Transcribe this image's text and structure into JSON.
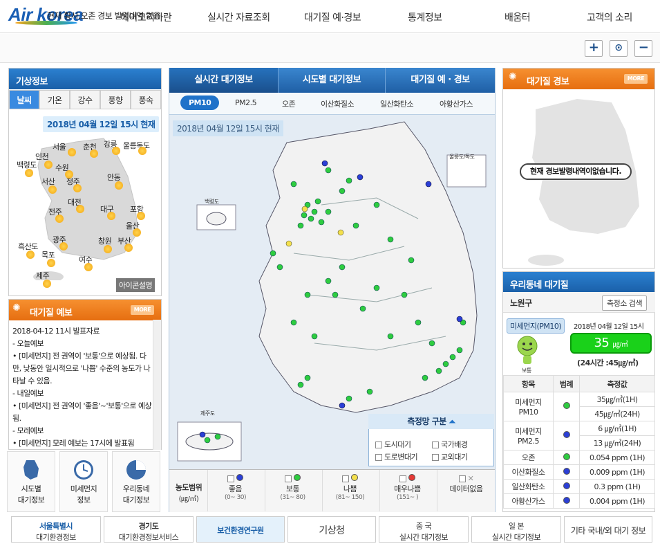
{
  "header": {
    "logo": "Air korea",
    "nav": [
      "에어코리아란",
      "실시간 자료조회",
      "대기질 예·경보",
      "통계정보",
      "배움터",
      "고객의 소리"
    ]
  },
  "notice": {
    "text": "현재 황사,오존 경보 발령내역 없음",
    "zoom_in": "+",
    "zoom_reset": "⊙",
    "zoom_out": "−"
  },
  "weather": {
    "title": "기상정보",
    "tabs": [
      "날씨",
      "기온",
      "강수",
      "풍향",
      "풍속"
    ],
    "date": "2018년 04월 12일 15시 현재",
    "cities": [
      "서울",
      "춘천",
      "강릉",
      "울릉독도",
      "인천",
      "수원",
      "백령도",
      "서산",
      "청주",
      "안동",
      "대전",
      "전주",
      "대구",
      "포항",
      "울산",
      "광주",
      "창원",
      "부산",
      "흑산도",
      "목포",
      "여수",
      "제주"
    ],
    "icon_help": "아이콘설명"
  },
  "forecast": {
    "title": "대기질 예보",
    "more": "MORE",
    "lines": [
      "2018-04-12 11시 발표자료",
      "- 오늘예보",
      "• [미세먼지] 전 권역이 '보통'으로 예상됨. 다만, 낮동안 일시적으로 '나쁨' 수준의 농도가 나타날 수 있음.",
      "- 내일예보",
      "• [미세먼지] 전 권역이 '좋음'~'보통'으로 예상됨.",
      "- 모레예보",
      "• [미세먼지] 모레 예보는 17시에 발표됨"
    ]
  },
  "tools": [
    {
      "line1": "시도별",
      "line2": "대기정보"
    },
    {
      "line1": "미세먼지",
      "line2": "정보"
    },
    {
      "line1": "우리동네",
      "line2": "대기정보"
    }
  ],
  "center": {
    "tabs": [
      "실시간 대기정보",
      "시도별 대기정보",
      "대기질 예 · 경보"
    ],
    "pollutants": [
      "PM10",
      "PM2.5",
      "오존",
      "이산화질소",
      "일산화탄소",
      "아황산가스"
    ],
    "date": "2018년 04월 12일 15시 현재",
    "islands": [
      "울릉도/독도",
      "백령도",
      "제주도"
    ],
    "legend_title": "측정망 구분",
    "legend_items": [
      "도시대기",
      "국가배경",
      "도로변대기",
      "교외대기"
    ],
    "range_label": "농도범위",
    "range_unit": "(㎍/㎥)",
    "ranges": [
      {
        "name": "좋음",
        "value": "(0~ 30)",
        "color": "#2b3fd6"
      },
      {
        "name": "보통",
        "value": "(31~ 80)",
        "color": "#2ecc40"
      },
      {
        "name": "나쁨",
        "value": "(81~ 150)",
        "color": "#f4e04d"
      },
      {
        "name": "매우나쁨",
        "value": "(151~ )",
        "color": "#e53935"
      },
      {
        "name": "데이터없음",
        "value": "",
        "color": "#999999"
      }
    ]
  },
  "alert": {
    "title": "대기질 경보",
    "more": "MORE",
    "message": "현재 경보발령내역이없습니다."
  },
  "local": {
    "title": "우리동네 대기질",
    "district": "노원구",
    "search_button": "측정소 검색",
    "badge": "미세먼지(PM10)",
    "date": "2018년 04월 12일 15시",
    "value": "35",
    "value_unit": "㎍/㎥",
    "avg24": "(24시간 :45㎍/㎥)",
    "face_label": "보통",
    "table_head": [
      "항목",
      "범례",
      "측정값"
    ],
    "rows": [
      {
        "item": "미세먼지",
        "sub": "PM10",
        "color": "#2ecc40",
        "v1": "35㎍/㎥(1H)",
        "v2": "45㎍/㎥(24H)"
      },
      {
        "item": "미세먼지",
        "sub": "PM2.5",
        "color": "#2b3fd6",
        "v1": "6 ㎍/㎥(1H)",
        "v2": "13 ㎍/㎥(24H)"
      },
      {
        "item": "오존",
        "sub": "",
        "color": "#2ecc40",
        "v1": "0.054 ppm (1H)",
        "v2": ""
      },
      {
        "item": "이산화질소",
        "sub": "",
        "color": "#2b3fd6",
        "v1": "0.009 ppm (1H)",
        "v2": ""
      },
      {
        "item": "일산화탄소",
        "sub": "",
        "color": "#2b3fd6",
        "v1": "0.3 ppm (1H)",
        "v2": ""
      },
      {
        "item": "아황산가스",
        "sub": "",
        "color": "#2b3fd6",
        "v1": "0.004 ppm (1H)",
        "v2": ""
      }
    ]
  },
  "banners": [
    {
      "l1": "서울특별시",
      "l2": "대기환경정보"
    },
    {
      "l1": "경기도",
      "l2": "대기환경정보서비스"
    },
    {
      "l1": "보건환경연구원",
      "l2": ""
    },
    {
      "l1": "기상청",
      "l2": ""
    },
    {
      "l1": "중 국",
      "l2": "실시간 대기정보"
    },
    {
      "l1": "일 본",
      "l2": "실시간 대기정보"
    },
    {
      "l1": "기타 국내/외 대기 정보",
      "l2": ""
    }
  ]
}
